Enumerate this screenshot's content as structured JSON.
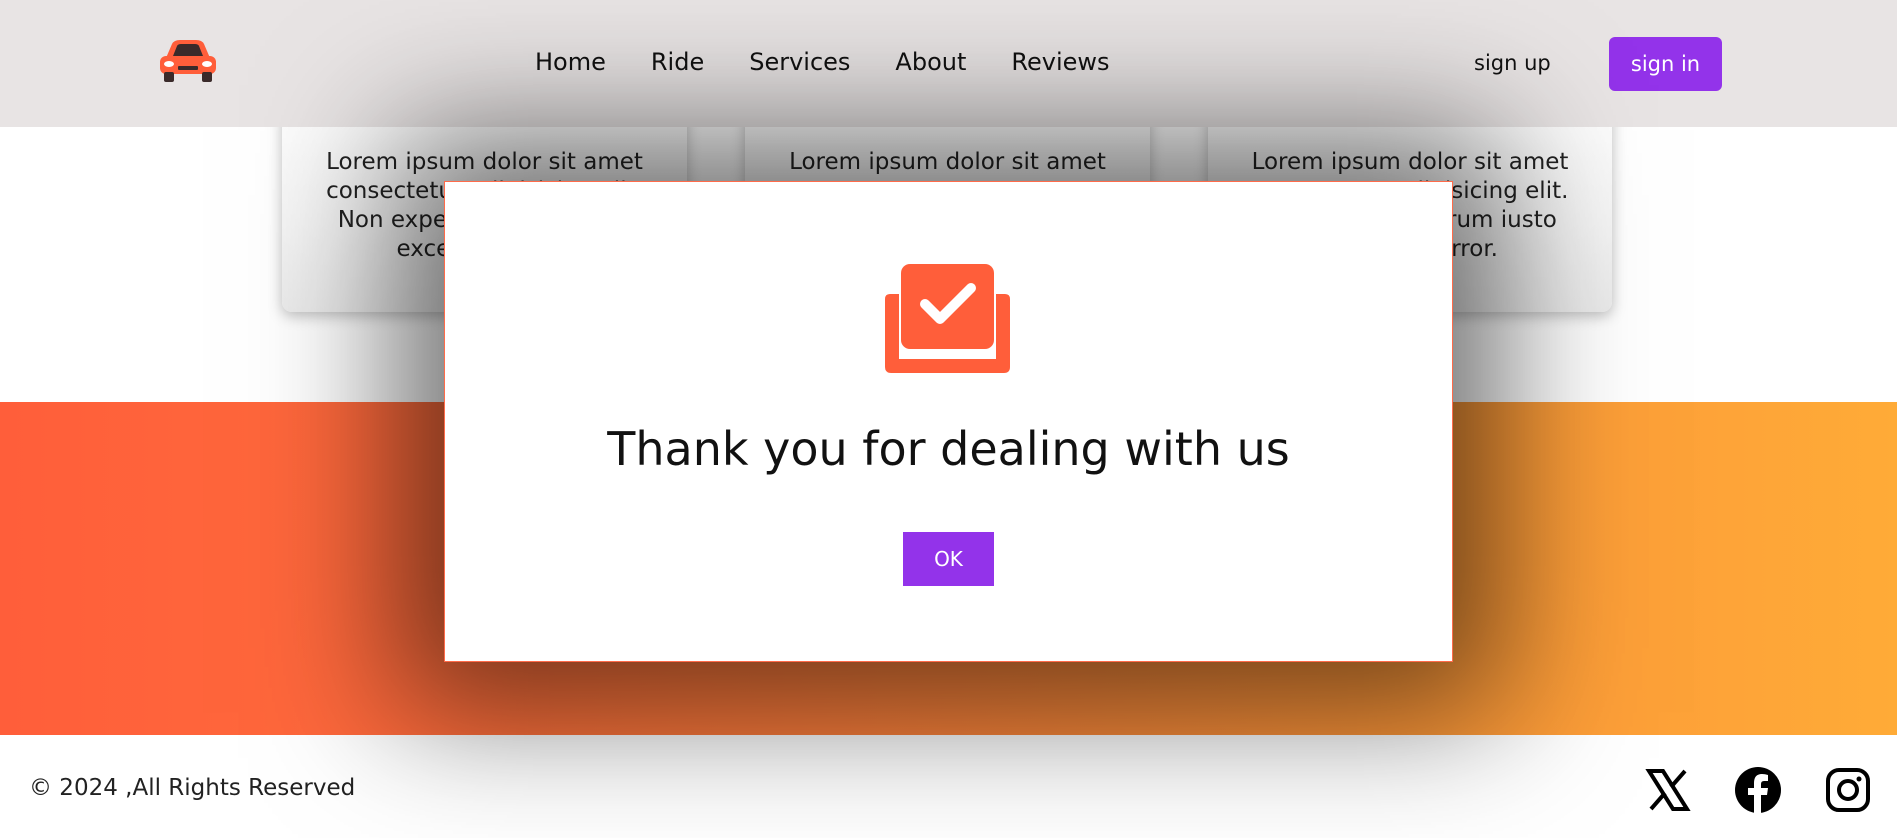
{
  "header": {
    "nav": [
      "Home",
      "Ride",
      "Services",
      "About",
      "Reviews"
    ],
    "sign_up": "sign up",
    "sign_in": "sign in"
  },
  "cards": [
    {
      "text": "Lorem ipsum dolor sit amet consectetur adipisicing elit. Non expedita rerum iusto excepturi error."
    },
    {
      "text": "Lorem ipsum dolor sit amet"
    },
    {
      "text": "Lorem ipsum dolor sit amet consectetur adipisicing elit. Non expedita rerum iusto excepturi error."
    }
  ],
  "modal": {
    "title": "Thank you for dealing with us",
    "ok_label": "OK"
  },
  "footer": {
    "copyright": "© 2024 ,All Rights Reserved",
    "social": [
      "x-icon",
      "facebook-icon",
      "instagram-icon"
    ]
  },
  "colors": {
    "accent": "#9333ea",
    "brand_orange": "#ff5e3a",
    "band_end": "#ffab37",
    "header_bg": "#e8e4e4"
  }
}
